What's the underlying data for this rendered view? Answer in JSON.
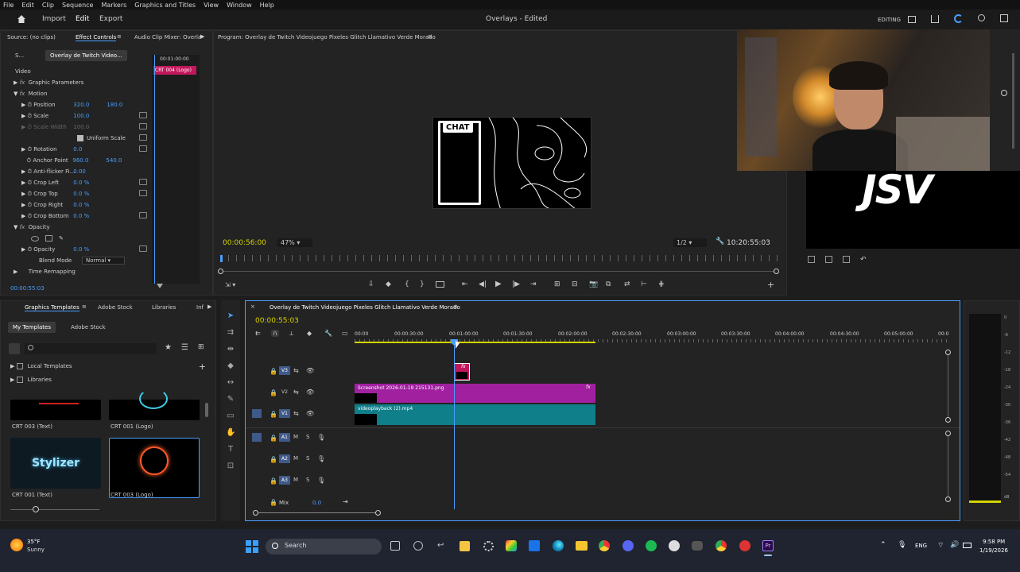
{
  "menu": [
    "File",
    "Edit",
    "Clip",
    "Sequence",
    "Markers",
    "Graphics and Titles",
    "View",
    "Window",
    "Help"
  ],
  "topbar": {
    "import": "Import",
    "edit": "Edit",
    "export": "Export",
    "title": "Overlays - Edited",
    "workspace": "EDITING"
  },
  "effect_panel": {
    "tabs": {
      "source": "Source: (no clips)",
      "effect_controls": "Effect Controls",
      "audio_mixer": "Audio Clip Mixer: Overla"
    },
    "subtabs": {
      "s": "S...",
      "clip": "Overlay de Twitch Video..."
    },
    "time_top": "00:01:00:00",
    "clip_label": "CRT 004 (Logo)",
    "video": "Video",
    "graphic_params": "Graphic Parameters",
    "motion": "Motion",
    "position_label": "Position",
    "position_x": "320.0",
    "position_y": "180.0",
    "scale_label": "Scale",
    "scale_val": "100.0",
    "scale_width_label": "Scale Width",
    "scale_width_val": "100.0",
    "uniform_scale": "Uniform Scale",
    "rotation_label": "Rotation",
    "rotation_val": "0.0",
    "anchor_label": "Anchor Point",
    "anchor_x": "960.0",
    "anchor_y": "540.0",
    "antiflicker_label": "Anti-flicker Fi...",
    "antiflicker_val": "0.00",
    "crop_left_label": "Crop Left",
    "crop_left_val": "0.0 %",
    "crop_top_label": "Crop Top",
    "crop_top_val": "0.0 %",
    "crop_right_label": "Crop Right",
    "crop_right_val": "0.0 %",
    "crop_bottom_label": "Crop Bottom",
    "crop_bottom_val": "0.0 %",
    "opacity": "Opacity",
    "opacity_label": "Opacity",
    "opacity_val": "0.0 %",
    "blend_label": "Blend Mode",
    "blend_val": "Normal",
    "time_remap": "Time Remapping",
    "timecode": "00:00:55:03"
  },
  "program": {
    "title": "Program: Overlay de Twitch Videojuego Pixeles Glitch Llamativo Verde Morado",
    "chat": "CHAT",
    "timecode": "00:00:56:00",
    "zoom": "47%",
    "resolution": "1/2",
    "duration": "10:20:55:03"
  },
  "webcam": {
    "logo": "JSV"
  },
  "templates": {
    "tabs": {
      "graphics": "Graphics Templates",
      "stock": "Adobe Stock",
      "libraries": "Libraries",
      "info": "Inf"
    },
    "subtabs": {
      "my": "My Templates",
      "stock": "Adobe Stock"
    },
    "local": "Local Templates",
    "libraries": "Libraries",
    "items": [
      {
        "name": "CRT 003 (Text)"
      },
      {
        "name": "CRT 001 (Logo)"
      },
      {
        "name": "CRT 001 (Text)",
        "thumb_text": "Stylizer"
      },
      {
        "name": "CRT 003 (Logo)"
      }
    ]
  },
  "timeline": {
    "title": "Overlay de Twitch Videojuego Pixeles Glitch Llamativo Verde Morado",
    "timecode": "00:00:55:03",
    "ruler": [
      "00:00",
      "00:00:30:00",
      "00:01:00:00",
      "00:01:30:00",
      "00:02:00:00",
      "00:02:30:00",
      "00:03:00:00",
      "00:03:30:00",
      "00:04:00:00",
      "00:04:30:00",
      "00:05:00:00",
      "00:0"
    ],
    "tracks": [
      "V3",
      "V2",
      "V1",
      "A1",
      "A2",
      "A3"
    ],
    "mix_label": "Mix",
    "mix_val": "0.0",
    "clip_v2": "Screenshot 2026-01-19 215131.png",
    "clip_v1": "videoplayback (2).mp4",
    "fx": "fx"
  },
  "meter": {
    "ticks": [
      "0",
      "-6",
      "-12",
      "-18",
      "-24",
      "-30",
      "-36",
      "-42",
      "-48",
      "-54",
      "dB"
    ]
  },
  "taskbar": {
    "temp": "35°F",
    "weather": "Sunny",
    "search": "Search",
    "lang": "ENG",
    "time": "9:58 PM",
    "date": "1/19/2026"
  },
  "colors": {
    "accent": "#4a9eff",
    "pink": "#c2185b",
    "purple": "#a020a0",
    "teal": "#0f7f8a",
    "yellow": "#d4d400"
  }
}
